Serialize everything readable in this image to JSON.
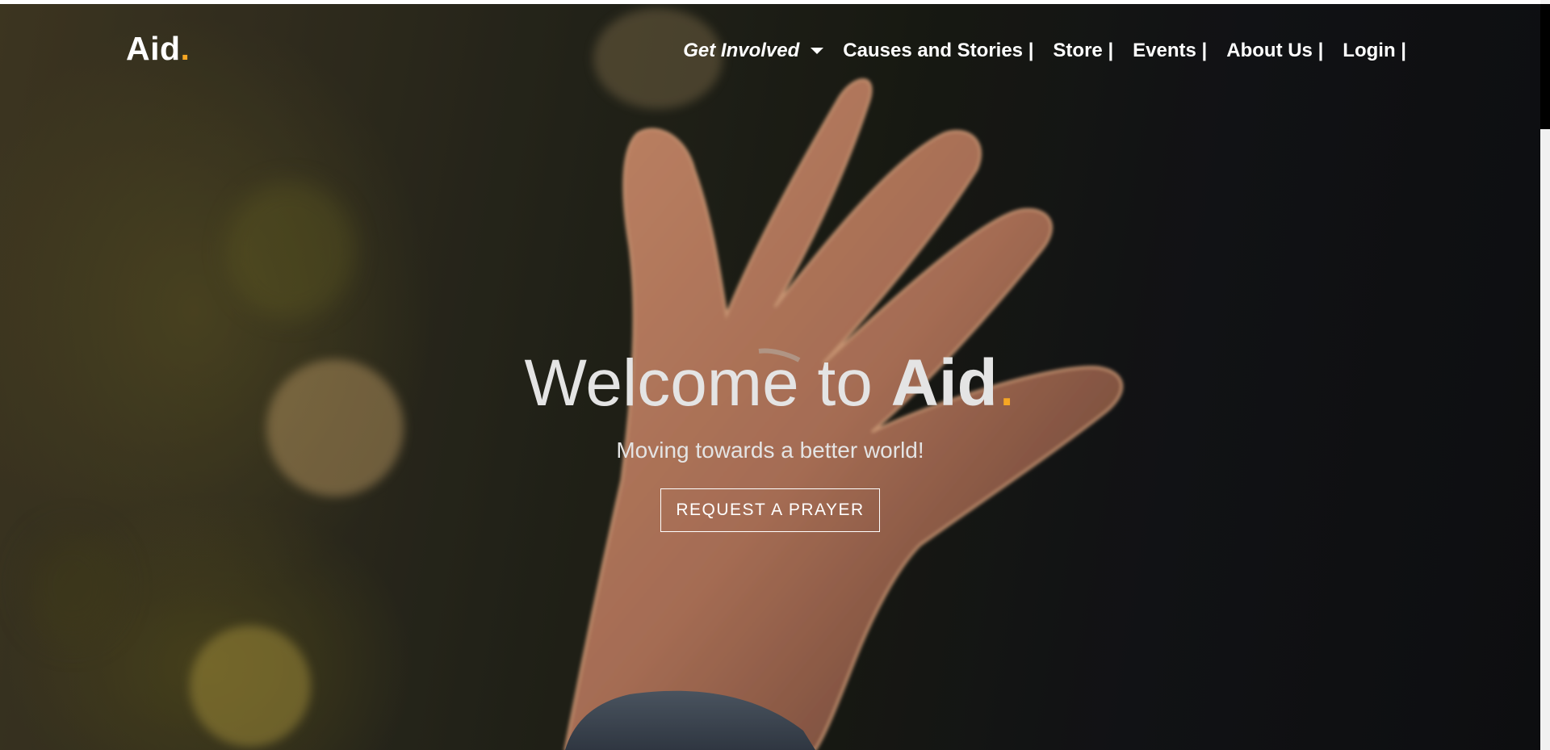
{
  "brand": {
    "name": "Aid",
    "dot": ".",
    "accent_color": "#f5a623"
  },
  "nav": {
    "items": [
      {
        "label": "Get Involved",
        "has_dropdown": true
      },
      {
        "label": "Causes and Stories |"
      },
      {
        "label": "Store |"
      },
      {
        "label": "Events |"
      },
      {
        "label": "About Us |"
      },
      {
        "label": "Login |"
      }
    ]
  },
  "hero": {
    "title_prefix": "Welcome to ",
    "title_brand": "Aid",
    "title_dot": ".",
    "subtitle": "Moving towards a better world!",
    "cta_label": "REQUEST A PRAYER"
  },
  "colors": {
    "text": "#e4e4e4",
    "nav_text": "#ffffff",
    "accent": "#f5a623"
  }
}
